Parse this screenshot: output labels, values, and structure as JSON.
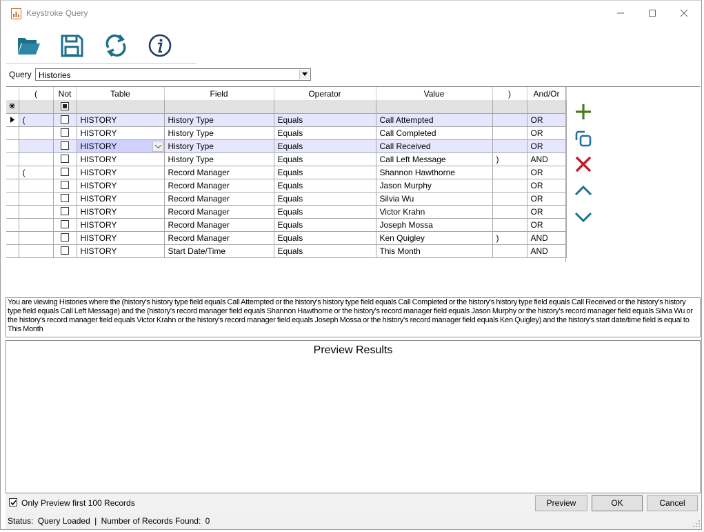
{
  "window": {
    "title": "Keystroke Query"
  },
  "toolbar": {
    "buttons": [
      {
        "name": "open-folder",
        "icon": "folder-open-icon"
      },
      {
        "name": "save",
        "icon": "save-icon"
      },
      {
        "name": "refresh",
        "icon": "refresh-icon"
      },
      {
        "name": "info",
        "icon": "info-icon"
      }
    ]
  },
  "query": {
    "label": "Query",
    "value": "Histories"
  },
  "grid": {
    "columns": [
      "(",
      "Not",
      "Table",
      "Field",
      "Operator",
      "Value",
      ")",
      "And/Or"
    ],
    "rows": [
      {
        "open": "(",
        "table": "HISTORY",
        "field": "History Type",
        "operator": "Equals",
        "value": "Call Attempted",
        "close": "",
        "andor": "OR"
      },
      {
        "open": "",
        "table": "HISTORY",
        "field": "History Type",
        "operator": "Equals",
        "value": "Call Completed",
        "close": "",
        "andor": "OR"
      },
      {
        "open": "",
        "table": "HISTORY",
        "field": "History Type",
        "operator": "Equals",
        "value": "Call Received",
        "close": "",
        "andor": "OR"
      },
      {
        "open": "",
        "table": "HISTORY",
        "field": "History Type",
        "operator": "Equals",
        "value": "Call Left Message",
        "close": ")",
        "andor": "AND"
      },
      {
        "open": "(",
        "table": "HISTORY",
        "field": "Record Manager",
        "operator": "Equals",
        "value": "Shannon Hawthorne",
        "close": "",
        "andor": "OR"
      },
      {
        "open": "",
        "table": "HISTORY",
        "field": "Record Manager",
        "operator": "Equals",
        "value": "Jason Murphy",
        "close": "",
        "andor": "OR"
      },
      {
        "open": "",
        "table": "HISTORY",
        "field": "Record Manager",
        "operator": "Equals",
        "value": "Silvia Wu",
        "close": "",
        "andor": "OR"
      },
      {
        "open": "",
        "table": "HISTORY",
        "field": "Record Manager",
        "operator": "Equals",
        "value": "Victor Krahn",
        "close": "",
        "andor": "OR"
      },
      {
        "open": "",
        "table": "HISTORY",
        "field": "Record Manager",
        "operator": "Equals",
        "value": "Joseph Mossa",
        "close": "",
        "andor": "OR"
      },
      {
        "open": "",
        "table": "HISTORY",
        "field": "Record Manager",
        "operator": "Equals",
        "value": "Ken Quigley",
        "close": ")",
        "andor": "AND"
      },
      {
        "open": "",
        "table": "HISTORY",
        "field": "Start Date/Time",
        "operator": "Equals",
        "value": "This Month",
        "close": "",
        "andor": "AND"
      }
    ]
  },
  "description": "You are viewing Histories where the (history's history type field equals Call Attempted or the history's history type field equals Call Completed or the history's history type field equals Call Received or the history's history type field equals Call Left Message) and the (history's record manager field equals Shannon Hawthorne or the history's record manager field equals Jason Murphy or the history's record manager field equals Silvia Wu or the history's record manager field equals Victor Krahn or the history's record manager field equals Joseph Mossa or the history's record manager field equals Ken Quigley) and the history's start date/time field is equal to This Month",
  "preview": {
    "header": "Preview Results"
  },
  "footer": {
    "only_preview_label": "Only Preview first 100 Records",
    "only_preview_checked": true,
    "preview_button": "Preview",
    "ok_button": "OK",
    "cancel_button": "Cancel"
  },
  "status": {
    "label": "Status:",
    "value": "Query Loaded",
    "separator": "|",
    "records_label": "Number of Records Found:",
    "records_value": "0"
  },
  "colors": {
    "teal": "#1d6f8a",
    "navy": "#1f3c63",
    "add_green": "#4a7a23",
    "copy_blue": "#1f6fa0",
    "delete_red": "#c21a2a",
    "selected_row": "#e6e6ff"
  }
}
